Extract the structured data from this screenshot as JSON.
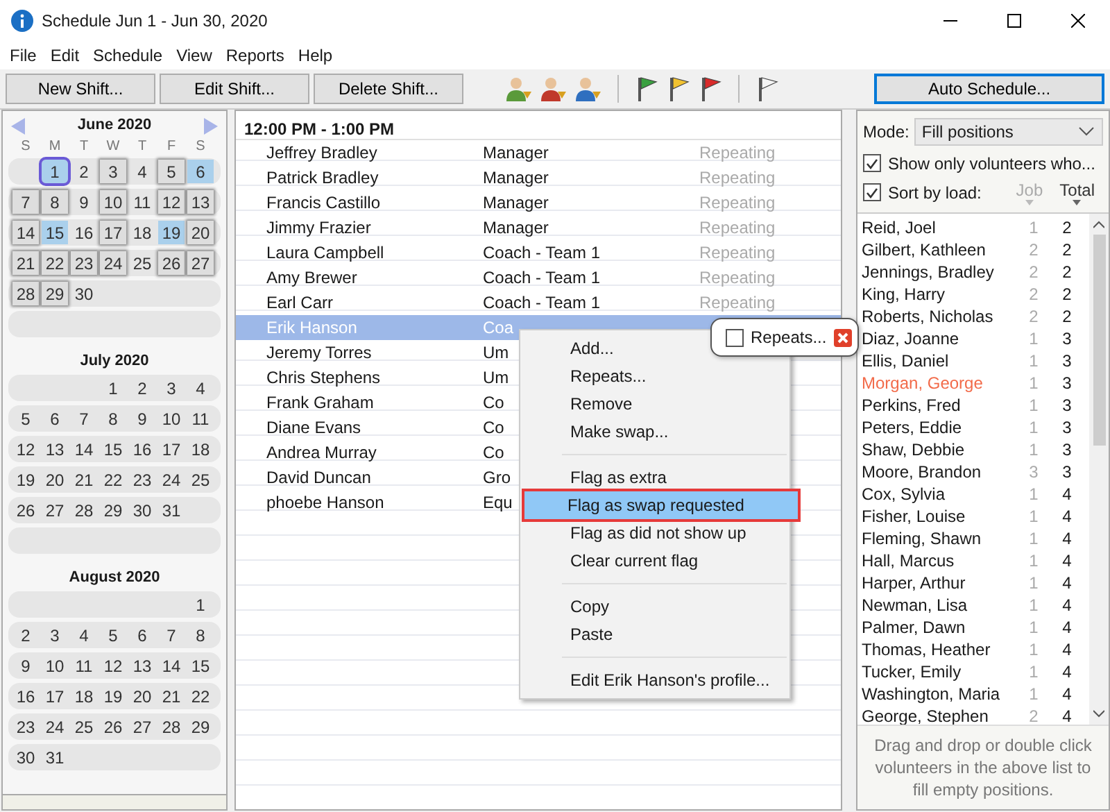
{
  "window": {
    "title": "Schedule Jun 1 - Jun 30, 2020"
  },
  "menu_bar": [
    "File",
    "Edit",
    "Schedule",
    "View",
    "Reports",
    "Help"
  ],
  "toolbar": {
    "buttons": [
      "New Shift...",
      "Edit Shift...",
      "Delete Shift..."
    ],
    "auto_schedule": "Auto Schedule..."
  },
  "calendar": {
    "weekdays": [
      "S",
      "M",
      "T",
      "W",
      "T",
      "F",
      "S"
    ],
    "months": [
      {
        "title": "June 2020",
        "weeks": [
          [
            {
              "d": "1",
              "kind": "highlighted",
              "today": true
            },
            {
              "d": "2",
              "kind": "plain"
            },
            {
              "d": "3",
              "kind": "shift"
            },
            {
              "d": "4",
              "kind": "plain"
            },
            {
              "d": "5",
              "kind": "shift"
            },
            {
              "d": "6",
              "kind": "highlighted"
            }
          ],
          [
            {
              "d": "7",
              "kind": "shift"
            },
            {
              "d": "8",
              "kind": "shift"
            },
            {
              "d": "9",
              "kind": "plain"
            },
            {
              "d": "10",
              "kind": "shift"
            },
            {
              "d": "11",
              "kind": "plain"
            },
            {
              "d": "12",
              "kind": "shift"
            },
            {
              "d": "13",
              "kind": "shift"
            }
          ],
          [
            {
              "d": "14",
              "kind": "shift"
            },
            {
              "d": "15",
              "kind": "highlighted"
            },
            {
              "d": "16",
              "kind": "plain"
            },
            {
              "d": "17",
              "kind": "shift"
            },
            {
              "d": "18",
              "kind": "plain"
            },
            {
              "d": "19",
              "kind": "highlighted"
            },
            {
              "d": "20",
              "kind": "shift"
            }
          ],
          [
            {
              "d": "21",
              "kind": "shift"
            },
            {
              "d": "22",
              "kind": "shift"
            },
            {
              "d": "23",
              "kind": "shift"
            },
            {
              "d": "24",
              "kind": "shift"
            },
            {
              "d": "25",
              "kind": "plain"
            },
            {
              "d": "26",
              "kind": "shift"
            },
            {
              "d": "27",
              "kind": "shift"
            }
          ],
          [
            {
              "d": "28",
              "kind": "shift"
            },
            {
              "d": "29",
              "kind": "shift"
            },
            {
              "d": "30",
              "kind": "plain"
            }
          ]
        ]
      },
      {
        "title": "July 2020",
        "weeks": [
          [
            "1",
            "2",
            "3",
            "4"
          ],
          [
            "5",
            "6",
            "7",
            "8",
            "9",
            "10",
            "11"
          ],
          [
            "12",
            "13",
            "14",
            "15",
            "16",
            "17",
            "18"
          ],
          [
            "19",
            "20",
            "21",
            "22",
            "23",
            "24",
            "25"
          ],
          [
            "26",
            "27",
            "28",
            "29",
            "30",
            "31"
          ]
        ]
      },
      {
        "title": "August 2020",
        "weeks": [
          [
            "1"
          ],
          [
            "2",
            "3",
            "4",
            "5",
            "6",
            "7",
            "8"
          ],
          [
            "9",
            "10",
            "11",
            "12",
            "13",
            "14",
            "15"
          ],
          [
            "16",
            "17",
            "18",
            "19",
            "20",
            "21",
            "22"
          ],
          [
            "23",
            "24",
            "25",
            "26",
            "27",
            "28",
            "29"
          ],
          [
            "30",
            "31"
          ]
        ]
      }
    ]
  },
  "shifts": {
    "time": "12:00 PM - 1:00 PM",
    "rows": [
      {
        "name": "Jeffrey Bradley",
        "role": "Manager",
        "status": "Repeating",
        "selected": false
      },
      {
        "name": "Patrick Bradley",
        "role": "Manager",
        "status": "Repeating",
        "selected": false
      },
      {
        "name": "Francis Castillo",
        "role": "Manager",
        "status": "Repeating",
        "selected": false
      },
      {
        "name": "Jimmy Frazier",
        "role": "Manager",
        "status": "Repeating",
        "selected": false
      },
      {
        "name": "Laura Campbell",
        "role": "Coach - Team 1",
        "status": "Repeating",
        "selected": false
      },
      {
        "name": "Amy Brewer",
        "role": "Coach - Team 1",
        "status": "Repeating",
        "selected": false
      },
      {
        "name": "Earl Carr",
        "role": "Coach - Team 1",
        "status": "Repeating",
        "selected": false
      },
      {
        "name": "Erik Hanson",
        "role": "Coa",
        "selected": true
      },
      {
        "name": "Jeremy Torres",
        "role": "Um",
        "selected": false
      },
      {
        "name": "Chris Stephens",
        "role": "Um",
        "selected": false
      },
      {
        "name": "Frank Graham",
        "role": "Co",
        "selected": false
      },
      {
        "name": "Diane Evans",
        "role": "Co",
        "selected": false
      },
      {
        "name": "Andrea Murray",
        "role": "Co",
        "selected": false
      },
      {
        "name": "David Duncan",
        "role": "Gro",
        "selected": false
      },
      {
        "name": "phoebe Hanson",
        "role": "Equ",
        "selected": false
      }
    ]
  },
  "context_menu": [
    {
      "kind": "item",
      "label": "Add...",
      "selected": false
    },
    {
      "kind": "item",
      "label": "Repeats...",
      "selected": false
    },
    {
      "kind": "item",
      "label": "Remove",
      "selected": false
    },
    {
      "kind": "item",
      "label": "Make swap...",
      "selected": false
    },
    {
      "kind": "separator"
    },
    {
      "kind": "item",
      "label": "Flag as extra",
      "selected": false
    },
    {
      "kind": "item",
      "label": "Flag as swap requested",
      "selected": true
    },
    {
      "kind": "item",
      "label": "Flag as did not show up",
      "selected": false
    },
    {
      "kind": "item",
      "label": "Clear current flag",
      "selected": false
    },
    {
      "kind": "separator"
    },
    {
      "kind": "item",
      "label": "Copy",
      "selected": false
    },
    {
      "kind": "item",
      "label": "Paste",
      "selected": false
    },
    {
      "kind": "separator"
    },
    {
      "kind": "item",
      "label": "Edit Erik Hanson's profile...",
      "selected": false
    }
  ],
  "repeats_popup": {
    "label": "Repeats...",
    "checked": false
  },
  "volunteers": {
    "mode_label": "Mode:",
    "mode": "Fill positions",
    "show_only": {
      "label": "Show only volunteers who...",
      "checked": true
    },
    "sort_by_load": {
      "label": "Sort by load:",
      "checked": true
    },
    "columns": [
      "Job",
      "Total"
    ],
    "rows": [
      {
        "name": "Reid, Joel",
        "job": "1",
        "total": "2",
        "color": "#1a1a1a"
      },
      {
        "name": "Gilbert, Kathleen",
        "job": "2",
        "total": "2",
        "color": "#1a1a1a"
      },
      {
        "name": "Jennings, Bradley",
        "job": "2",
        "total": "2",
        "color": "#1a1a1a"
      },
      {
        "name": "King, Harry",
        "job": "2",
        "total": "2",
        "color": "#1a1a1a"
      },
      {
        "name": "Roberts, Nicholas",
        "job": "2",
        "total": "2",
        "color": "#1a1a1a"
      },
      {
        "name": "Diaz, Joanne",
        "job": "1",
        "total": "3",
        "color": "#1a1a1a"
      },
      {
        "name": "Ellis, Daniel",
        "job": "1",
        "total": "3",
        "color": "#1a1a1a"
      },
      {
        "name": "Morgan, George",
        "job": "1",
        "total": "3",
        "color": "#f26b4a"
      },
      {
        "name": "Perkins, Fred",
        "job": "1",
        "total": "3",
        "color": "#1a1a1a"
      },
      {
        "name": "Peters, Eddie",
        "job": "1",
        "total": "3",
        "color": "#1a1a1a"
      },
      {
        "name": "Shaw, Debbie",
        "job": "1",
        "total": "3",
        "color": "#1a1a1a"
      },
      {
        "name": "Moore, Brandon",
        "job": "3",
        "total": "3",
        "color": "#1a1a1a"
      },
      {
        "name": "Cox, Sylvia",
        "job": "1",
        "total": "4",
        "color": "#1a1a1a"
      },
      {
        "name": "Fisher, Louise",
        "job": "1",
        "total": "4",
        "color": "#1a1a1a"
      },
      {
        "name": "Fleming, Shawn",
        "job": "1",
        "total": "4",
        "color": "#1a1a1a"
      },
      {
        "name": "Hall, Marcus",
        "job": "1",
        "total": "4",
        "color": "#1a1a1a"
      },
      {
        "name": "Harper, Arthur",
        "job": "1",
        "total": "4",
        "color": "#1a1a1a"
      },
      {
        "name": "Newman, Lisa",
        "job": "1",
        "total": "4",
        "color": "#1a1a1a"
      },
      {
        "name": "Palmer, Dawn",
        "job": "1",
        "total": "4",
        "color": "#1a1a1a"
      },
      {
        "name": "Thomas, Heather",
        "job": "1",
        "total": "4",
        "color": "#1a1a1a"
      },
      {
        "name": "Tucker, Emily",
        "job": "1",
        "total": "4",
        "color": "#1a1a1a"
      },
      {
        "name": "Washington, Maria",
        "job": "1",
        "total": "4",
        "color": "#1a1a1a"
      },
      {
        "name": "George, Stephen",
        "job": "2",
        "total": "4",
        "color": "#1a1a1a"
      }
    ],
    "hint": "Drag and drop or double click volunteers in the above list to fill empty positions."
  }
}
